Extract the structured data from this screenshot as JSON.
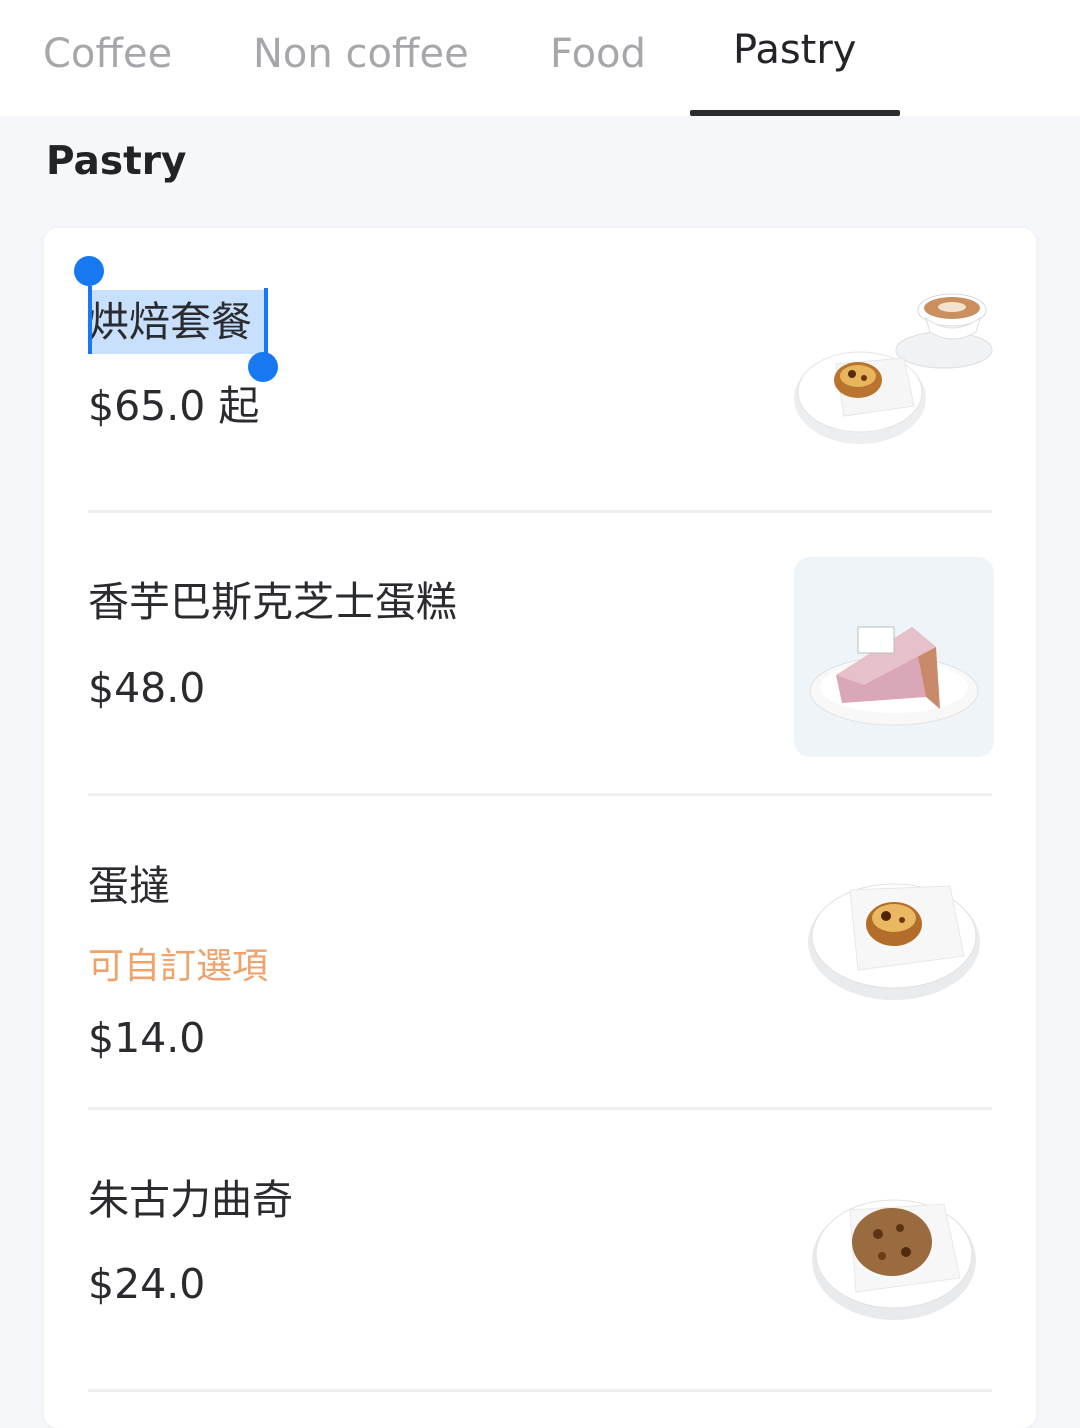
{
  "tabs": [
    {
      "label": "Coffee"
    },
    {
      "label": "Non coffee"
    },
    {
      "label": "Food"
    },
    {
      "label": "Pastry",
      "active": true
    }
  ],
  "section": {
    "title": "Pastry"
  },
  "items": [
    {
      "name": "烘焙套餐",
      "price": "$65.0 起",
      "image": "egg-tart-and-latte-photo",
      "selected": true
    },
    {
      "name": "香芋巴斯克芝士蛋糕",
      "price": "$48.0",
      "image": "taro-cheesecake-photo"
    },
    {
      "name": "蛋撻",
      "tag": "可自訂選項",
      "price": "$14.0",
      "image": "egg-tart-photo"
    },
    {
      "name": "朱古力曲奇",
      "price": "$24.0",
      "image": "chocolate-cookie-photo"
    }
  ],
  "colors": {
    "accent_tag": "#f0a26b",
    "selection": "#1778f2",
    "active_tab": "#222427",
    "inactive_tab": "#a5a7ab"
  }
}
